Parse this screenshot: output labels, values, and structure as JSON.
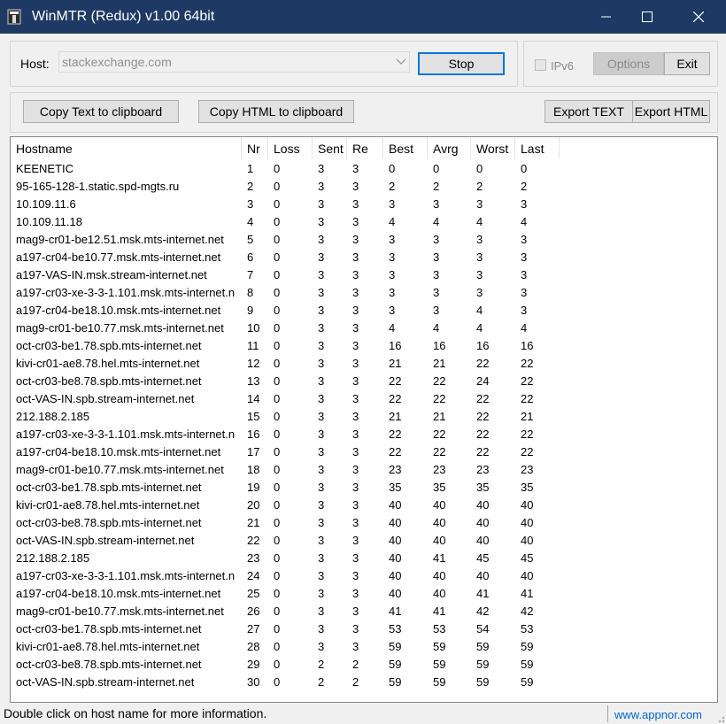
{
  "window": {
    "title": "WinMTR (Redux) v1.00 64bit",
    "title_bar_color": "#1e3a64"
  },
  "top": {
    "host_label": "Host:",
    "host_value": "stackexchange.com",
    "stop_label": "Stop",
    "ipv6_label": "IPv6",
    "ipv6_checked": false,
    "options_label": "Options",
    "exit_label": "Exit"
  },
  "toolbar": {
    "copy_text_label": "Copy Text to clipboard",
    "copy_html_label": "Copy HTML to clipboard",
    "export_text_label": "Export TEXT",
    "export_html_label": "Export HTML"
  },
  "table": {
    "headers": [
      "Hostname",
      "Nr",
      "Loss",
      "Sent",
      "Re",
      "Best",
      "Avrg",
      "Worst",
      "Last"
    ],
    "rows": [
      [
        "KEENETIC",
        "1",
        "0",
        "3",
        "3",
        "0",
        "0",
        "0",
        "0"
      ],
      [
        "95-165-128-1.static.spd-mgts.ru",
        "2",
        "0",
        "3",
        "3",
        "2",
        "2",
        "2",
        "2"
      ],
      [
        "10.109.11.6",
        "3",
        "0",
        "3",
        "3",
        "3",
        "3",
        "3",
        "3"
      ],
      [
        "10.109.11.18",
        "4",
        "0",
        "3",
        "3",
        "4",
        "4",
        "4",
        "4"
      ],
      [
        "mag9-cr01-be12.51.msk.mts-internet.net",
        "5",
        "0",
        "3",
        "3",
        "3",
        "3",
        "3",
        "3"
      ],
      [
        "a197-cr04-be10.77.msk.mts-internet.net",
        "6",
        "0",
        "3",
        "3",
        "3",
        "3",
        "3",
        "3"
      ],
      [
        "a197-VAS-IN.msk.stream-internet.net",
        "7",
        "0",
        "3",
        "3",
        "3",
        "3",
        "3",
        "3"
      ],
      [
        "a197-cr03-xe-3-3-1.101.msk.mts-internet.n",
        "8",
        "0",
        "3",
        "3",
        "3",
        "3",
        "3",
        "3"
      ],
      [
        "a197-cr04-be18.10.msk.mts-internet.net",
        "9",
        "0",
        "3",
        "3",
        "3",
        "3",
        "4",
        "3"
      ],
      [
        "mag9-cr01-be10.77.msk.mts-internet.net",
        "10",
        "0",
        "3",
        "3",
        "4",
        "4",
        "4",
        "4"
      ],
      [
        "oct-cr03-be1.78.spb.mts-internet.net",
        "11",
        "0",
        "3",
        "3",
        "16",
        "16",
        "16",
        "16"
      ],
      [
        "kivi-cr01-ae8.78.hel.mts-internet.net",
        "12",
        "0",
        "3",
        "3",
        "21",
        "21",
        "22",
        "22"
      ],
      [
        "oct-cr03-be8.78.spb.mts-internet.net",
        "13",
        "0",
        "3",
        "3",
        "22",
        "22",
        "24",
        "22"
      ],
      [
        "oct-VAS-IN.spb.stream-internet.net",
        "14",
        "0",
        "3",
        "3",
        "22",
        "22",
        "22",
        "22"
      ],
      [
        "212.188.2.185",
        "15",
        "0",
        "3",
        "3",
        "21",
        "21",
        "22",
        "21"
      ],
      [
        "a197-cr03-xe-3-3-1.101.msk.mts-internet.n",
        "16",
        "0",
        "3",
        "3",
        "22",
        "22",
        "22",
        "22"
      ],
      [
        "a197-cr04-be18.10.msk.mts-internet.net",
        "17",
        "0",
        "3",
        "3",
        "22",
        "22",
        "22",
        "22"
      ],
      [
        "mag9-cr01-be10.77.msk.mts-internet.net",
        "18",
        "0",
        "3",
        "3",
        "23",
        "23",
        "23",
        "23"
      ],
      [
        "oct-cr03-be1.78.spb.mts-internet.net",
        "19",
        "0",
        "3",
        "3",
        "35",
        "35",
        "35",
        "35"
      ],
      [
        "kivi-cr01-ae8.78.hel.mts-internet.net",
        "20",
        "0",
        "3",
        "3",
        "40",
        "40",
        "40",
        "40"
      ],
      [
        "oct-cr03-be8.78.spb.mts-internet.net",
        "21",
        "0",
        "3",
        "3",
        "40",
        "40",
        "40",
        "40"
      ],
      [
        "oct-VAS-IN.spb.stream-internet.net",
        "22",
        "0",
        "3",
        "3",
        "40",
        "40",
        "40",
        "40"
      ],
      [
        "212.188.2.185",
        "23",
        "0",
        "3",
        "3",
        "40",
        "41",
        "45",
        "45"
      ],
      [
        "a197-cr03-xe-3-3-1.101.msk.mts-internet.n",
        "24",
        "0",
        "3",
        "3",
        "40",
        "40",
        "40",
        "40"
      ],
      [
        "a197-cr04-be18.10.msk.mts-internet.net",
        "25",
        "0",
        "3",
        "3",
        "40",
        "40",
        "41",
        "41"
      ],
      [
        "mag9-cr01-be10.77.msk.mts-internet.net",
        "26",
        "0",
        "3",
        "3",
        "41",
        "41",
        "42",
        "42"
      ],
      [
        "oct-cr03-be1.78.spb.mts-internet.net",
        "27",
        "0",
        "3",
        "3",
        "53",
        "53",
        "54",
        "53"
      ],
      [
        "kivi-cr01-ae8.78.hel.mts-internet.net",
        "28",
        "0",
        "3",
        "3",
        "59",
        "59",
        "59",
        "59"
      ],
      [
        "oct-cr03-be8.78.spb.mts-internet.net",
        "29",
        "0",
        "2",
        "2",
        "59",
        "59",
        "59",
        "59"
      ],
      [
        "oct-VAS-IN.spb.stream-internet.net",
        "30",
        "0",
        "2",
        "2",
        "59",
        "59",
        "59",
        "59"
      ]
    ]
  },
  "status": {
    "message": "Double click on host name for more information.",
    "link": "www.appnor.com",
    "link_color": "#0066cc"
  },
  "icons": [
    "app-icon",
    "minimize-icon",
    "maximize-icon",
    "close-icon",
    "chevron-down-icon",
    "resize-grip-icon"
  ]
}
